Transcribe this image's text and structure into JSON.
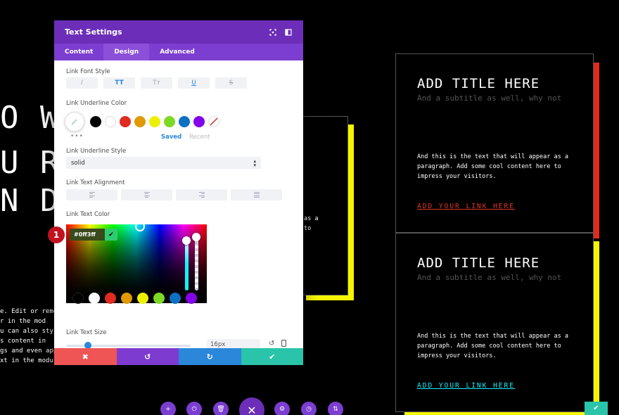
{
  "background": {
    "heading_lines": [
      "O W",
      "U R",
      "N D"
    ],
    "paragraph_lines": [
      "e. Edit or remo",
      "r  in  the  mod",
      "u  can  also  sty",
      "s  content  in",
      "gs  and  even  app",
      "xt  in  the  modu"
    ],
    "mid_lines": [
      "as a",
      "to"
    ]
  },
  "cards": [
    {
      "title": "ADD TITLE HERE",
      "subtitle": "And a subtitle as well, why not",
      "body": "And this is the text that will appear as a paragraph. Add some cool content here to impress your visitors.",
      "link": "ADD YOUR LINK HERE",
      "link_color": "#e03626",
      "shadow_color": "#e02b20"
    },
    {
      "title": "ADD TITLE HERE",
      "subtitle": "And a subtitle as well, why not",
      "body": "And this is the text that will appear as a paragraph. Add some cool content here to impress your visitors.",
      "link": "ADD YOUR LINK HERE",
      "link_color": "#0ff3ff",
      "shadow_color": "#f6f600"
    }
  ],
  "modal": {
    "title": "Text Settings",
    "tabs": [
      {
        "label": "Content",
        "active": false
      },
      {
        "label": "Design",
        "active": true
      },
      {
        "label": "Advanced",
        "active": false
      }
    ],
    "link_font_style": {
      "label": "Link Font Style",
      "buttons": [
        "I",
        "TT",
        "Tт",
        "U",
        "S"
      ]
    },
    "link_underline_color": {
      "label": "Link Underline Color",
      "swatches": [
        "#000000",
        "#ffffff",
        "#e02b20",
        "#e09900",
        "#edf000",
        "#7cda24",
        "#0c71c3",
        "#8300e9"
      ],
      "saved_label": "Saved",
      "recent_label": "Recent",
      "more": "•••"
    },
    "link_underline_style": {
      "label": "Link Underline Style",
      "value": "solid"
    },
    "link_text_alignment": {
      "label": "Link Text Alignment"
    },
    "link_text_color": {
      "label": "Link Text Color",
      "hex": "#0ff3ff",
      "swatches": [
        "#000000",
        "#ffffff",
        "#e02b20",
        "#e09900",
        "#edf000",
        "#7cda24",
        "#0c71c3",
        "#8300e9"
      ]
    },
    "link_text_size": {
      "label": "Link Text Size",
      "value": "16px"
    },
    "badge": "1",
    "footer": {
      "cancel": "✖",
      "undo": "↺",
      "redo": "↻",
      "save": "✔"
    }
  },
  "colors": {
    "modal_header": "#6c2eb9",
    "accent_blue": "#2b87da",
    "footer_red": "#ef5555",
    "footer_purple": "#7e3bd0",
    "footer_blue": "#2b87da",
    "footer_green": "#29c4a9"
  }
}
